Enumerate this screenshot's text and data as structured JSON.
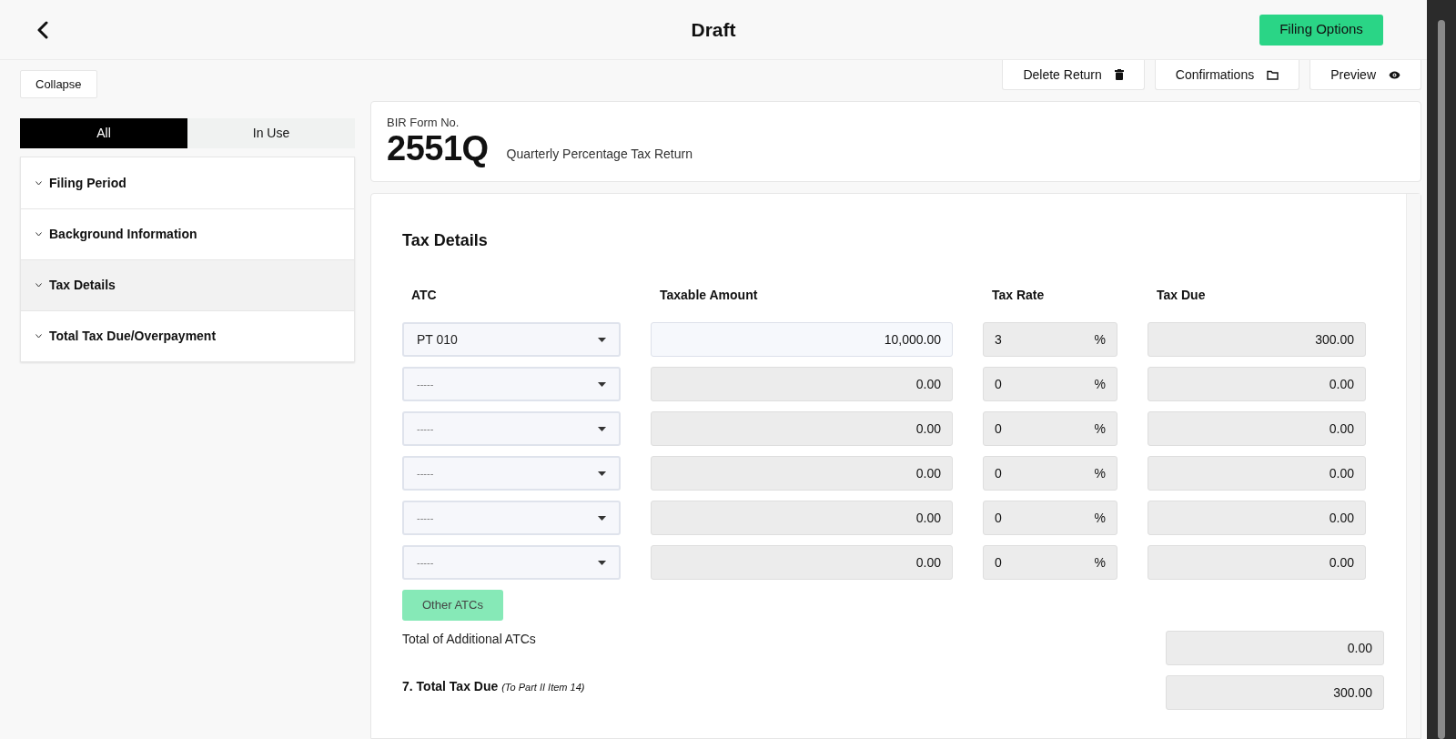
{
  "header": {
    "title": "Draft",
    "filing_options": "Filing Options"
  },
  "sidebar": {
    "collapse": "Collapse",
    "tabs": [
      {
        "label": "All",
        "selected": true
      },
      {
        "label": "In Use",
        "selected": false
      }
    ],
    "items": [
      {
        "label": "Filing Period",
        "selected": false
      },
      {
        "label": "Background Information",
        "selected": false
      },
      {
        "label": "Tax Details",
        "selected": true
      },
      {
        "label": "Total Tax Due/Overpayment",
        "selected": false
      }
    ]
  },
  "actions": [
    {
      "label": "Delete Return",
      "kind": "trash"
    },
    {
      "label": "Confirmations",
      "kind": "folder"
    },
    {
      "label": "Preview",
      "kind": "eye"
    }
  ],
  "form": {
    "label": "BIR Form No.",
    "number": "2551Q",
    "name": "Quarterly Percentage Tax Return"
  },
  "tax_details": {
    "title": "Tax Details",
    "columns": [
      "ATC",
      "Taxable Amount",
      "Tax Rate",
      "Tax Due"
    ],
    "rows": [
      {
        "atc": "PT 010",
        "atc_empty": false,
        "taxable_amount": "10,000.00",
        "amount_disabled": false,
        "tax_rate": "3",
        "rate_unit": "%",
        "tax_due": "300.00"
      },
      {
        "atc": "-----",
        "atc_empty": true,
        "taxable_amount": "0.00",
        "amount_disabled": true,
        "tax_rate": "0",
        "rate_unit": "%",
        "tax_due": "0.00"
      },
      {
        "atc": "-----",
        "atc_empty": true,
        "taxable_amount": "0.00",
        "amount_disabled": true,
        "tax_rate": "0",
        "rate_unit": "%",
        "tax_due": "0.00"
      },
      {
        "atc": "-----",
        "atc_empty": true,
        "taxable_amount": "0.00",
        "amount_disabled": true,
        "tax_rate": "0",
        "rate_unit": "%",
        "tax_due": "0.00"
      },
      {
        "atc": "-----",
        "atc_empty": true,
        "taxable_amount": "0.00",
        "amount_disabled": true,
        "tax_rate": "0",
        "rate_unit": "%",
        "tax_due": "0.00"
      },
      {
        "atc": "-----",
        "atc_empty": true,
        "taxable_amount": "0.00",
        "amount_disabled": true,
        "tax_rate": "0",
        "rate_unit": "%",
        "tax_due": "0.00"
      }
    ],
    "other_atcs": "Other ATCs",
    "additional_label": "Total of Additional ATCs",
    "additional_value": "0.00",
    "total_label": "7. Total Tax Due",
    "total_note": "(To Part II Item 14)",
    "total_value": "300.00"
  }
}
